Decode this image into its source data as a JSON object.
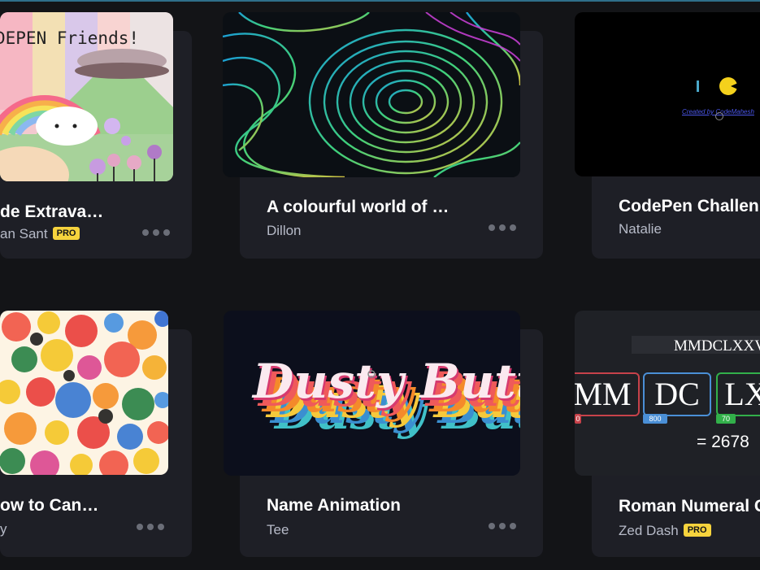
{
  "cards": [
    {
      "title": "de Extrava…",
      "author": "an Sant",
      "pro": "PRO",
      "thumb_text": "DEPEN Friends!"
    },
    {
      "title": "A colourful world of …",
      "author": "Dillon"
    },
    {
      "title": "CodePen Challen",
      "author": "Natalie",
      "thumb_credit": "Created by CodeMahesh"
    },
    {
      "title": "ow to Can…",
      "author": "y"
    },
    {
      "title": "Name Animation",
      "author": "Tee",
      "thumb_text": "Dusty Button"
    },
    {
      "title": "Roman Numeral C",
      "author": "Zed Dash",
      "pro": "PRO",
      "roman": {
        "display": "MMDCLXXV",
        "groups": [
          {
            "text": "MM",
            "value": "0",
            "color": "#c7424a"
          },
          {
            "text": "DC",
            "value": "800",
            "color": "#4a8fd6"
          },
          {
            "text": "LX",
            "value": "70",
            "color": "#32b04a"
          }
        ],
        "result": "= 2678"
      }
    }
  ],
  "more_icon": "more-horizontal-icon"
}
